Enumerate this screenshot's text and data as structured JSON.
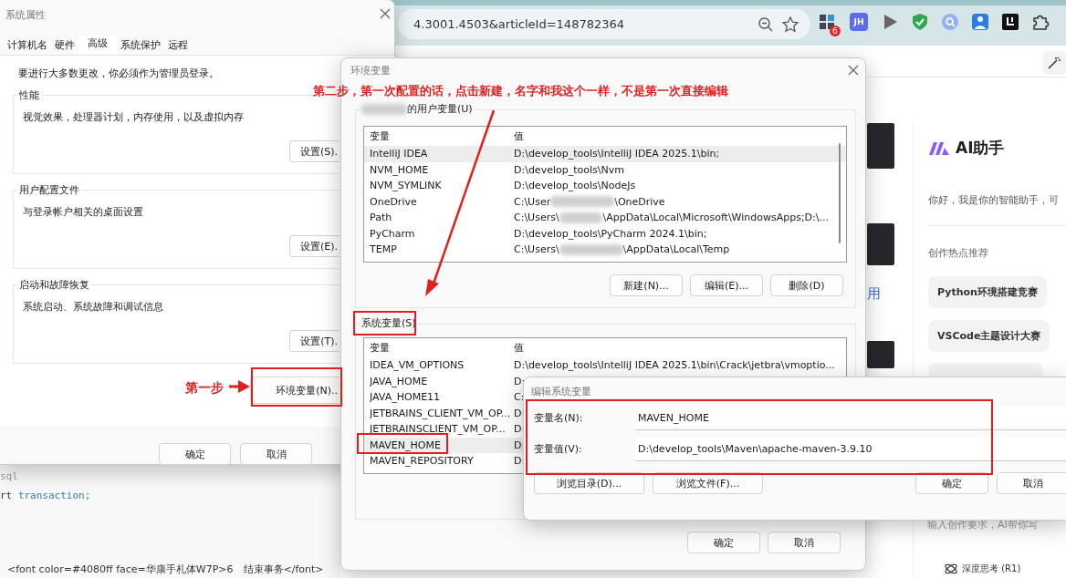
{
  "browser": {
    "address": "4.3001.4503&articleId=148782364",
    "extension_badge": "6",
    "extension_label": "JH"
  },
  "page_fragment": "用",
  "ai_panel": {
    "title": "AI助手",
    "greeting": "你好，我是你的智能助手，可",
    "section": "创作热点推荐",
    "chips": [
      "Python环境搭建竞赛",
      "VSCode主题设计大赛"
    ],
    "input_placeholder": "输入创作要求，AI帮你写",
    "deep_think": "深度思考 (R1)"
  },
  "code": {
    "lines": [
      {
        "kind": "comment",
        "text": "sql"
      },
      {
        "kind": "statement",
        "keyword": "rt",
        "text": "transaction;"
      }
    ],
    "markup_line": "<font color=#4080ff face=华康手札体W7P>6　结束事务</font>"
  },
  "system_properties": {
    "title": "系统属性",
    "tabs": [
      {
        "label": "计算机名",
        "selected": false
      },
      {
        "label": "硬件",
        "selected": false
      },
      {
        "label": "高级",
        "selected": true
      },
      {
        "label": "系统保护",
        "selected": false
      },
      {
        "label": "远程",
        "selected": false
      }
    ],
    "notice": "要进行大多数更改，你必须作为管理员登录。",
    "groups": [
      {
        "title": "性能",
        "description": "视觉效果，处理器计划，内存使用，以及虚拟内存",
        "button": "设置(S)."
      },
      {
        "title": "用户配置文件",
        "description": "与登录帐户相关的桌面设置",
        "button": "设置(E)."
      },
      {
        "title": "启动和故障恢复",
        "description": "系统启动、系统故障和调试信息",
        "button": "设置(T)."
      }
    ],
    "env_button": "环境变量(N)..",
    "footer_buttons": [
      "确定",
      "取消"
    ]
  },
  "env_vars": {
    "title": "环境变量",
    "user_group_label": "的用户变量(U)",
    "user_columns": [
      "变量",
      "值"
    ],
    "user_vars": [
      {
        "name": "IntelliJ IDEA",
        "value": "D:\\develop_tools\\IntelliJ IDEA 2025.1\\bin;",
        "selected": true
      },
      {
        "name": "NVM_HOME",
        "value": "D:\\develop_tools\\Nvm",
        "selected": false
      },
      {
        "name": "NVM_SYMLINK",
        "value": "D:\\develop_tools\\NodeJs",
        "selected": false
      },
      {
        "name": "OneDrive",
        "value": "C:\\User",
        "value_tail": "\\OneDrive",
        "selected": false
      },
      {
        "name": "Path",
        "value": "C:\\Users\\",
        "value_tail": "\\AppData\\Local\\Microsoft\\WindowsApps;D:\\...",
        "selected": false
      },
      {
        "name": "PyCharm",
        "value": "D:\\develop_tools\\PyCharm 2024.1\\bin;",
        "selected": false
      },
      {
        "name": "TEMP",
        "value": "C:\\Users\\",
        "value_tail": "\\AppData\\Local\\Temp",
        "selected": false
      }
    ],
    "user_buttons": [
      "新建(N)...",
      "编辑(E)...",
      "删除(D)"
    ],
    "system_group_label": "系统变量(S)",
    "system_columns": [
      "变量",
      "值"
    ],
    "system_vars": [
      {
        "name": "IDEA_VM_OPTIONS",
        "value": "D:\\develop_tools\\IntelliJ IDEA 2025.1\\bin\\Crack\\jetbra\\vmoptio...",
        "selected": false
      },
      {
        "name": "JAVA_HOME",
        "value": "D:",
        "selected": false
      },
      {
        "name": "JAVA_HOME11",
        "value": "C:",
        "selected": false
      },
      {
        "name": "JETBRAINS_CLIENT_VM_OP...",
        "value": "D:",
        "selected": false
      },
      {
        "name": "JETBRAINSCLIENT_VM_OP...",
        "value": "D:",
        "selected": false
      },
      {
        "name": "MAVEN_HOME",
        "value": "D:",
        "selected": true
      },
      {
        "name": "MAVEN_REPOSITORY",
        "value": "D:",
        "selected": false
      }
    ],
    "footer_buttons": [
      "确定",
      "取消"
    ]
  },
  "edit_dialog": {
    "title": "编辑系统变量",
    "fields": [
      {
        "label": "变量名(N):",
        "value": "MAVEN_HOME"
      },
      {
        "label": "变量值(V):",
        "value": "D:\\develop_tools\\Maven\\apache-maven-3.9.10"
      }
    ],
    "browse_buttons": [
      "浏览目录(D)...",
      "浏览文件(F)..."
    ],
    "buttons": [
      "确定",
      "取消"
    ]
  },
  "annotations": {
    "step1": "第一步",
    "step2": "第二步，第一次配置的话，点击新建，名字和我这个一样，不是第一次直接编辑"
  }
}
